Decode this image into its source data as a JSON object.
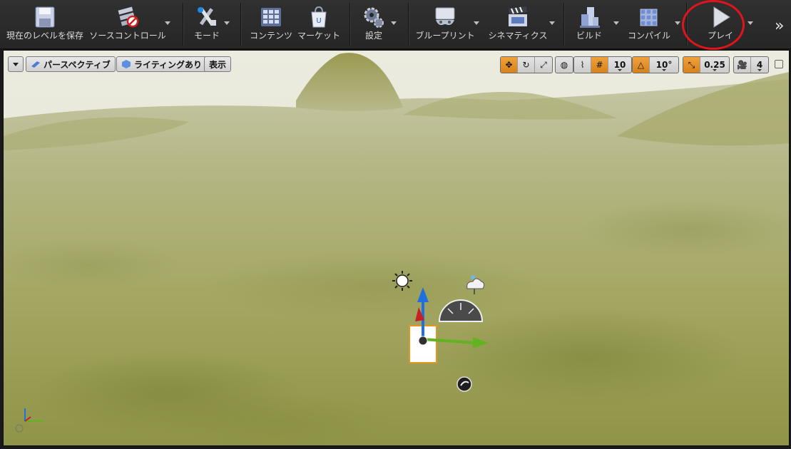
{
  "toolbar": {
    "save": "現在のレベルを保存",
    "source_control": "ソースコントロール",
    "modes": "モード",
    "content": "コンテンツ",
    "marketplace": "マーケット",
    "settings": "設定",
    "blueprints": "ブループリント",
    "cinematics": "シネマティクス",
    "build": "ビルド",
    "compile": "コンパイル",
    "play": "プレイ",
    "overflow": "»"
  },
  "viewport": {
    "perspective": "パースペクティブ",
    "lighting": "ライティングあり",
    "show": "表示",
    "grid_snap": "10",
    "rotation_snap": "10°",
    "scale_snap": "0.25",
    "camera_speed": "4"
  },
  "colors": {
    "play_highlight": "#e0141b",
    "snap_active": "#e8921f",
    "terrain": "#a9ad64"
  }
}
